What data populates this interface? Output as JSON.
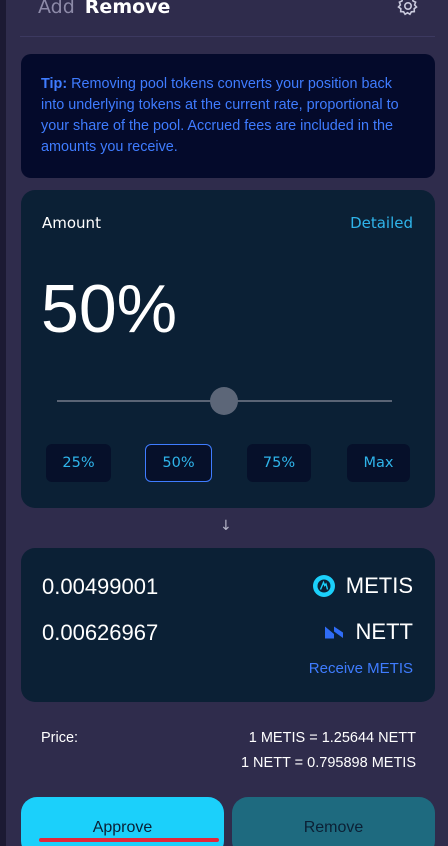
{
  "tabs": {
    "add": "Add",
    "remove": "Remove"
  },
  "settings_icon": "gear-icon",
  "tip": {
    "prefix": "Tip:",
    "text": " Removing pool tokens converts your position back into underlying tokens at the current rate, proportional to your share of the pool. Accrued fees are included in the amounts you receive."
  },
  "amount": {
    "label": "Amount",
    "detailed_link": "Detailed",
    "percent_display": "50%",
    "slider_value": 50,
    "presets": [
      "25%",
      "50%",
      "75%",
      "Max"
    ],
    "selected_preset": "50%"
  },
  "arrow": "↓",
  "output": {
    "rows": [
      {
        "amount": "0.00499001",
        "token": "METIS",
        "icon": "metis-icon"
      },
      {
        "amount": "0.00626967",
        "token": "NETT",
        "icon": "nett-icon"
      }
    ],
    "receive_link": "Receive METIS"
  },
  "price": {
    "label": "Price:",
    "line1": "1 METIS = 1.25644 NETT",
    "line2": "1 NETT = 0.795898 METIS"
  },
  "buttons": {
    "approve": "Approve",
    "remove": "Remove"
  },
  "colors": {
    "background": "#2f2c4c",
    "card": "#0b2035",
    "accent_cyan": "#1bd0fb",
    "link_blue": "#3f7cff",
    "remove_teal": "#1e6a7f"
  }
}
